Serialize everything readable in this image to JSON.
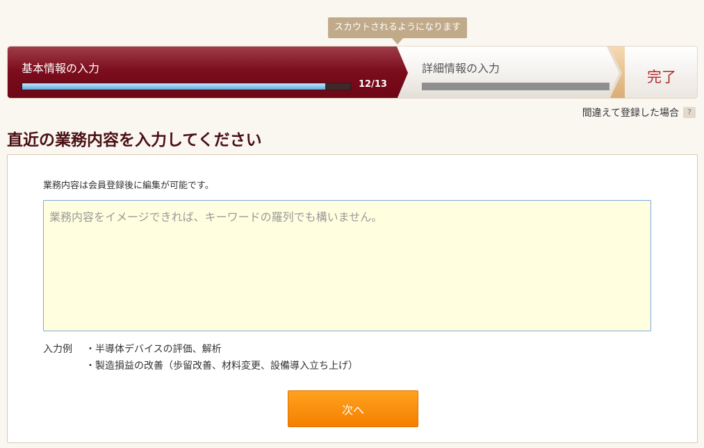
{
  "tooltip": {
    "text": "スカウトされるようになります"
  },
  "steps": {
    "basic": {
      "label": "基本情報の入力",
      "progress_text": "12/13",
      "progress": 0.923
    },
    "detail": {
      "label": "詳細情報の入力",
      "progress": 0
    },
    "done": {
      "label": "完了"
    }
  },
  "mistake_link": {
    "label": "間違えて登録した場合",
    "help_badge": "?"
  },
  "page_title": "直近の業務内容を入力してください",
  "form": {
    "help_text": "業務内容は会員登録後に編集が可能です。",
    "textarea_placeholder": "業務内容をイメージできれば、キーワードの羅列でも構いません。",
    "textarea_value": "",
    "example_label": "入力例",
    "examples": [
      "・半導体デバイスの評価、解析",
      "・製造損益の改善（歩留改善、材料変更、設備導入立ち上げ）"
    ],
    "next_button": "次へ"
  },
  "colors": {
    "accent": "#7c0d1c",
    "button": "#f57f00",
    "title": "#4a0f14",
    "textarea_bg": "#ffffe0"
  }
}
